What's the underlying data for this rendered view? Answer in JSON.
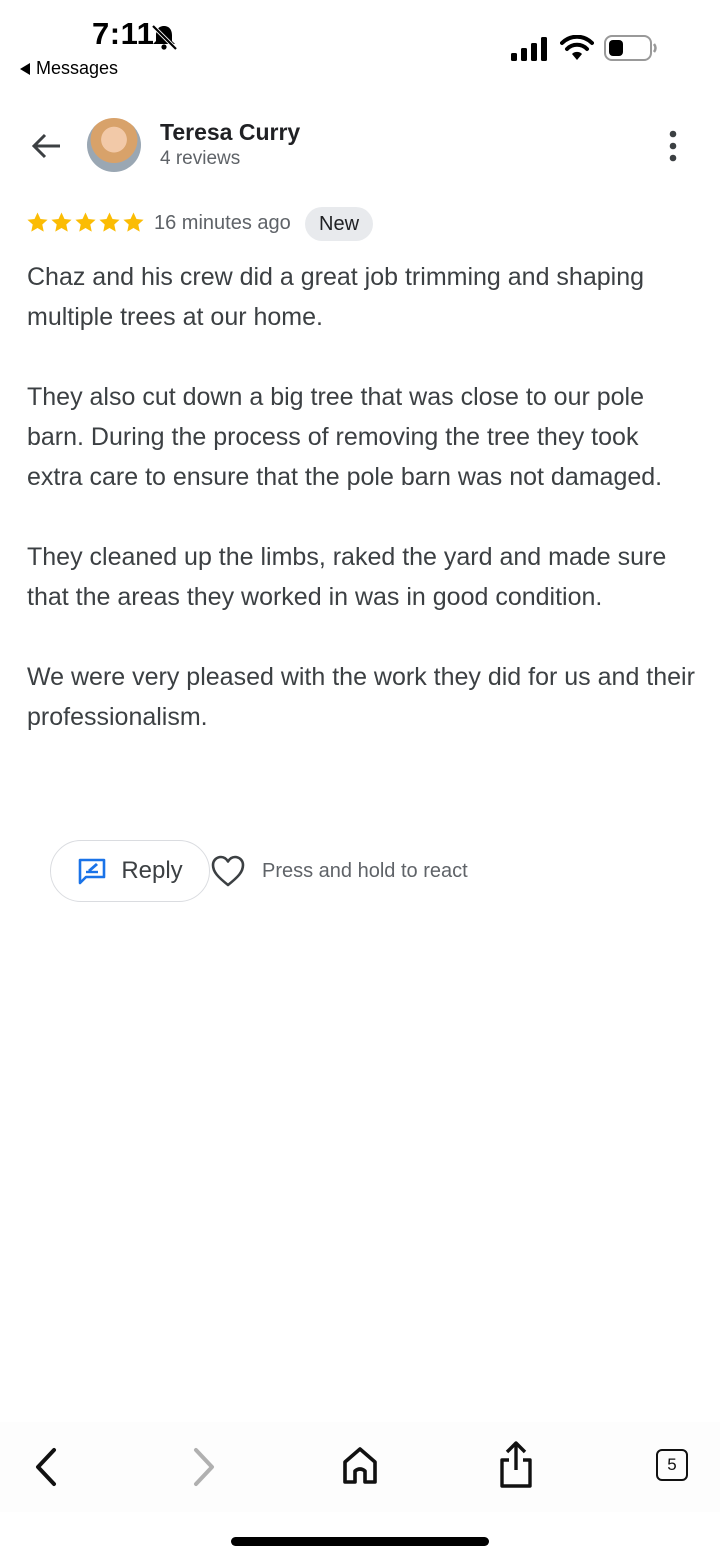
{
  "status_bar": {
    "time": "7:11",
    "back_label": "Messages"
  },
  "header": {
    "reviewer_name": "Teresa Curry",
    "reviewer_subtitle": "4 reviews"
  },
  "review": {
    "rating": 5,
    "max_rating": 5,
    "time_ago": "16 minutes ago",
    "badge": "New",
    "paragraphs": [
      "Chaz and his crew did a great job trimming and shaping multiple trees at our home.",
      "They also cut down a big tree that was close to our pole barn. During the process of removing the tree they took extra care to ensure that the pole barn was not damaged.",
      "They cleaned up the limbs, raked the yard and made sure that the areas they worked in was in good condition.",
      "We were very pleased with the work they did for us and their professionalism."
    ]
  },
  "actions": {
    "reply_label": "Reply",
    "react_hint": "Press and hold to react"
  },
  "toolbar": {
    "tab_count": "5"
  },
  "colors": {
    "star": "#fbbc04",
    "reply_icon": "#1a73e8",
    "badge_bg": "#e8eaed",
    "text_secondary": "#5f6368"
  }
}
